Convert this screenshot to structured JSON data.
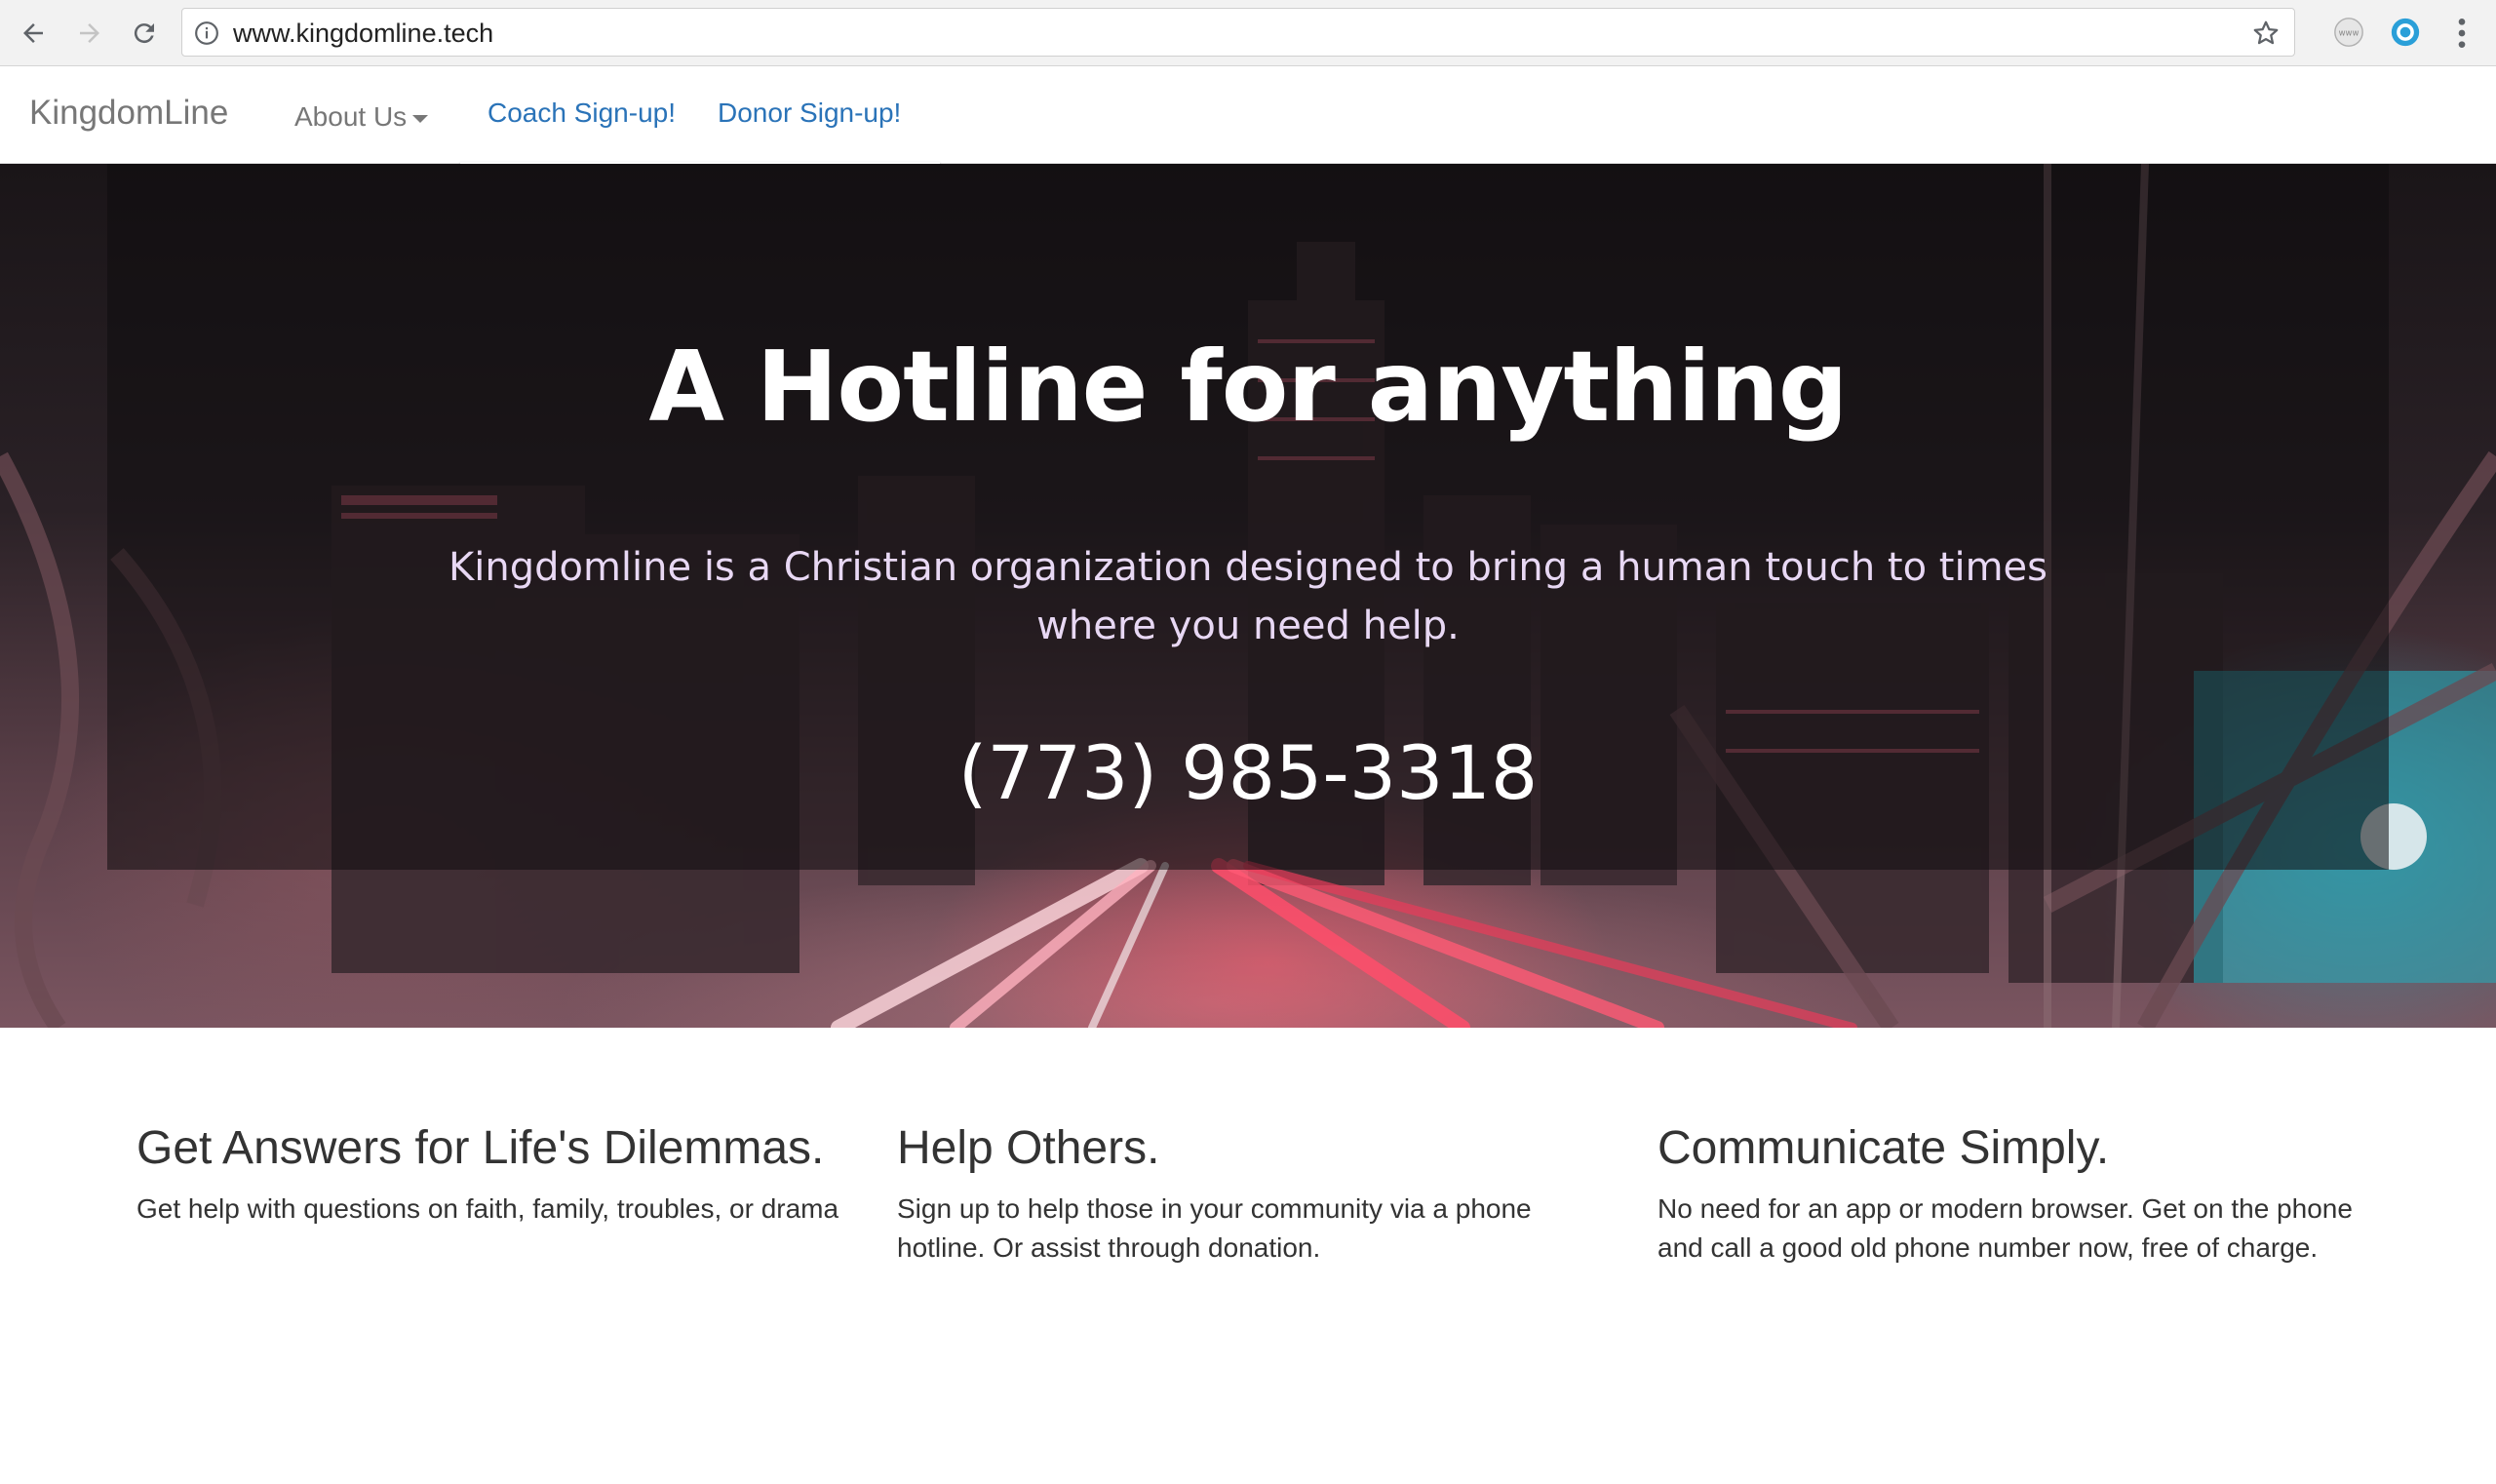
{
  "browser": {
    "url": "www.kingdomline.tech",
    "icons": [
      "back-arrow-icon",
      "forward-arrow-icon",
      "reload-icon",
      "info-icon",
      "star-icon",
      "www-extension-icon",
      "circle-extension-icon",
      "kebab-menu-icon"
    ]
  },
  "navbar": {
    "brand": "KingdomLine",
    "about": "About Us",
    "coach_signup": "Coach Sign-up!",
    "donor_signup": "Donor Sign-up!"
  },
  "hero": {
    "title": "A Hotline for anything",
    "subtitle": "Kingdomline is a Christian organization designed to bring a human touch to times where you need help.",
    "phone": "(773) 985-3318"
  },
  "features": [
    {
      "title": "Get Answers for Life's Dilemmas.",
      "body": "Get help with questions on faith, family, troubles, or drama"
    },
    {
      "title": "Help Others.",
      "body": "Sign up to help those in your community via a phone hotline. Or assist through donation."
    },
    {
      "title": "Communicate Simply.",
      "body": "No need for an app or modern browser. Get on the phone and call a good old phone number now, free of charge."
    }
  ],
  "colors": {
    "link": "#2a73b8",
    "nav_text": "#777777",
    "body_text": "#333333",
    "hero_subtitle": "#e8d8f4"
  }
}
